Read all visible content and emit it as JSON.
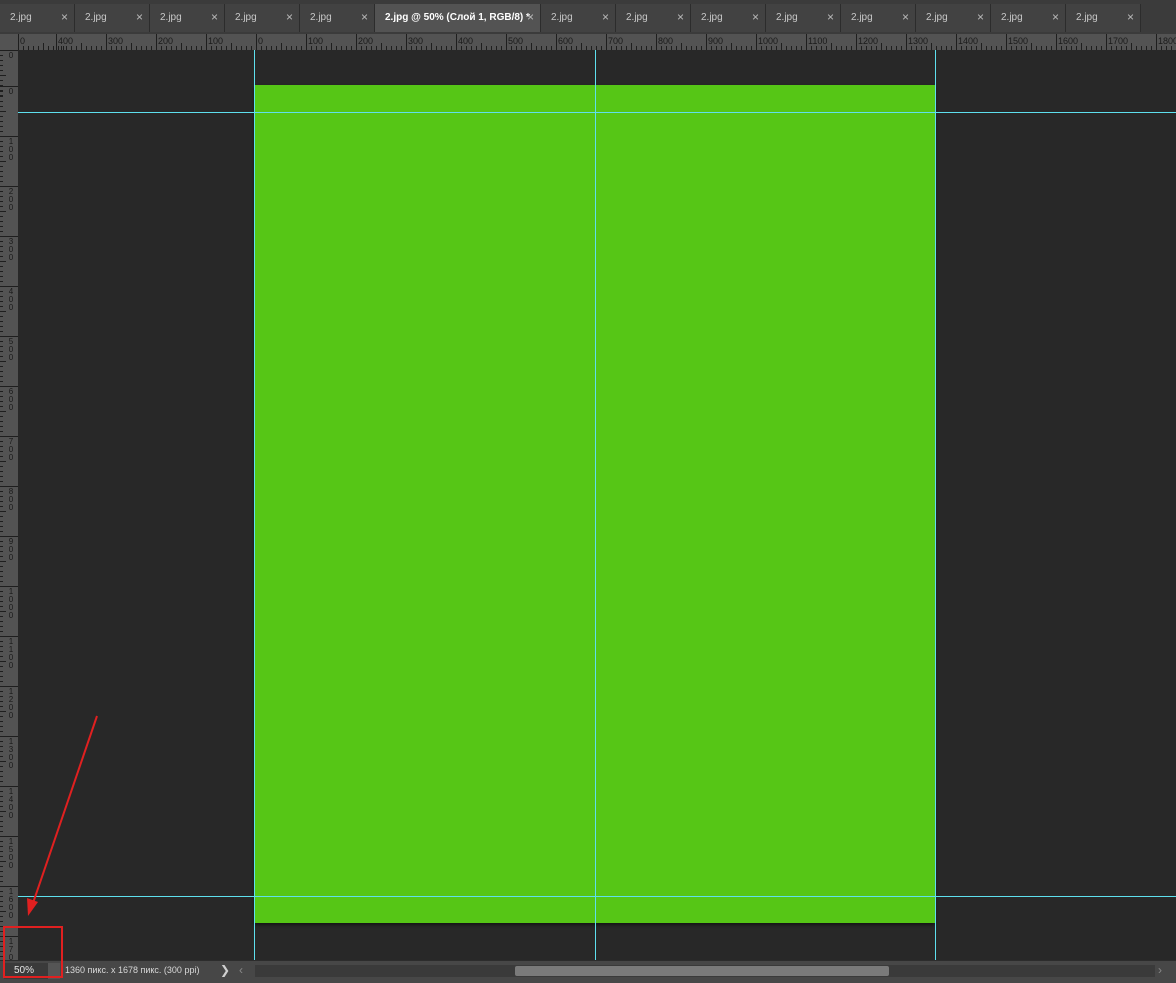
{
  "tabs": [
    {
      "label": "2.jpg",
      "close": "×"
    },
    {
      "label": "2.jpg",
      "close": "×"
    },
    {
      "label": "2.jpg",
      "close": "×"
    },
    {
      "label": "2.jpg",
      "close": "×"
    },
    {
      "label": "2.jpg",
      "close": "×"
    },
    {
      "label": "2.jpg @ 50% (Слой 1, RGB/8) *",
      "close": "×",
      "active": true
    },
    {
      "label": "2.jpg",
      "close": "×"
    },
    {
      "label": "2.jpg",
      "close": "×"
    },
    {
      "label": "2.jpg",
      "close": "×"
    },
    {
      "label": "2.jpg",
      "close": "×"
    },
    {
      "label": "2.jpg",
      "close": "×"
    },
    {
      "label": "2.jpg",
      "close": "×"
    },
    {
      "label": "2.jpg",
      "close": "×"
    },
    {
      "label": "2.jpg",
      "close": "×"
    }
  ],
  "ruler_h": {
    "labels": [
      "0",
      "400",
      "300",
      "200",
      "100",
      "0",
      "100",
      "200",
      "300",
      "400",
      "500",
      "600",
      "700",
      "800",
      "900",
      "1000",
      "1100",
      "1200",
      "1300",
      "1400",
      "1500",
      "1600",
      "1700",
      "1800"
    ]
  },
  "ruler_v": {
    "labels": [
      "0",
      "0",
      "100",
      "200",
      "300",
      "400",
      "500",
      "600",
      "700",
      "800",
      "900",
      "1000",
      "1100",
      "1200",
      "1300",
      "1400",
      "1500",
      "1600",
      "1700"
    ]
  },
  "canvas": {
    "background": "#282828",
    "artboard_color": "#56c616",
    "guide_color": "#5ee0ee"
  },
  "status": {
    "zoom": "50%",
    "doc_info": "1360 пикс. x 1678 пикс. (300 ppi)",
    "arrow": "❯",
    "scroll_left": "‹",
    "scroll_right": "›"
  },
  "annotation": {
    "color": "#e02020"
  }
}
